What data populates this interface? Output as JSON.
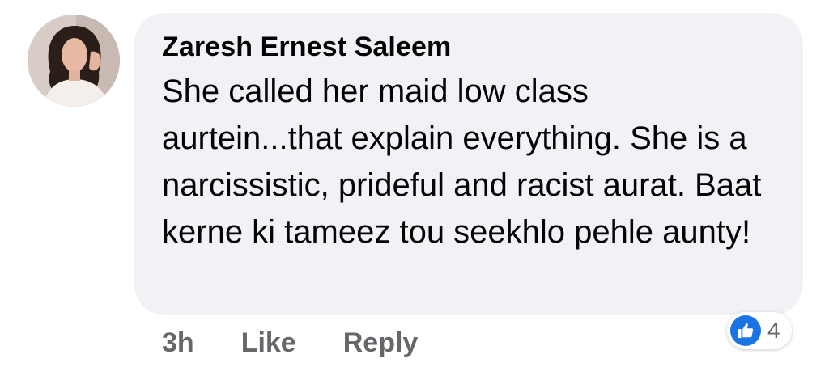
{
  "comment": {
    "author": "Zaresh Ernest Saleem",
    "text": "She called her maid low class aurtein...that explain everything. She is a narcissistic, prideful and racist aurat. Baat kerne ki tameez tou seekhlo pehle aunty!",
    "timestamp": "3h",
    "like_label": "Like",
    "reply_label": "Reply",
    "reaction_count": "4",
    "reaction_icon": "thumbs-up-icon"
  },
  "colors": {
    "bubble": "#f0f2f5",
    "meta_text": "#65676b",
    "like_blue": "#1b74e4"
  }
}
